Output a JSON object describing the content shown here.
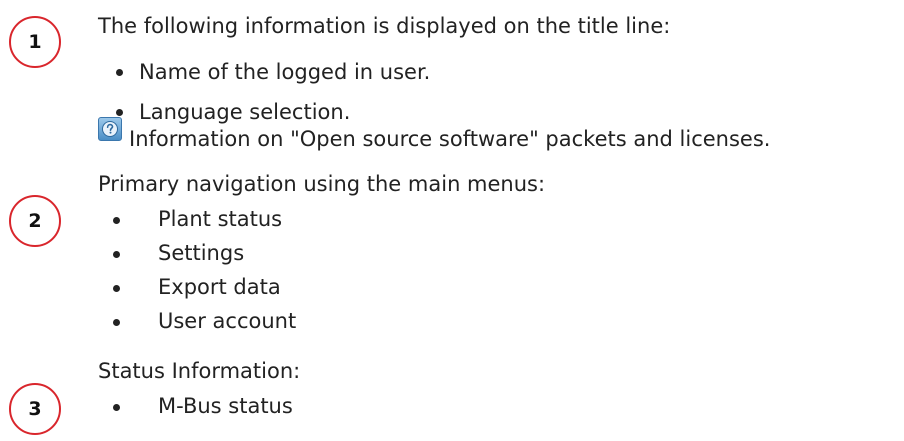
{
  "sections": [
    {
      "number": "1",
      "heading": "The following information is displayed on the title line:",
      "items": [
        "Name of the logged in user.",
        "Language selection."
      ],
      "icon_note": {
        "icon": "help-icon",
        "text": "Information on \"Open source software\" packets and licenses."
      }
    },
    {
      "number": "2",
      "heading": "Primary navigation using the main menus:",
      "items": [
        "Plant status",
        "Settings",
        "Export data",
        "User account"
      ]
    },
    {
      "number": "3",
      "heading": "Status Information:",
      "items": [
        "M-Bus status"
      ]
    }
  ],
  "colors": {
    "badge_border": "#d9262c",
    "text": "#222222",
    "icon_fill": "#4a8ec6"
  }
}
